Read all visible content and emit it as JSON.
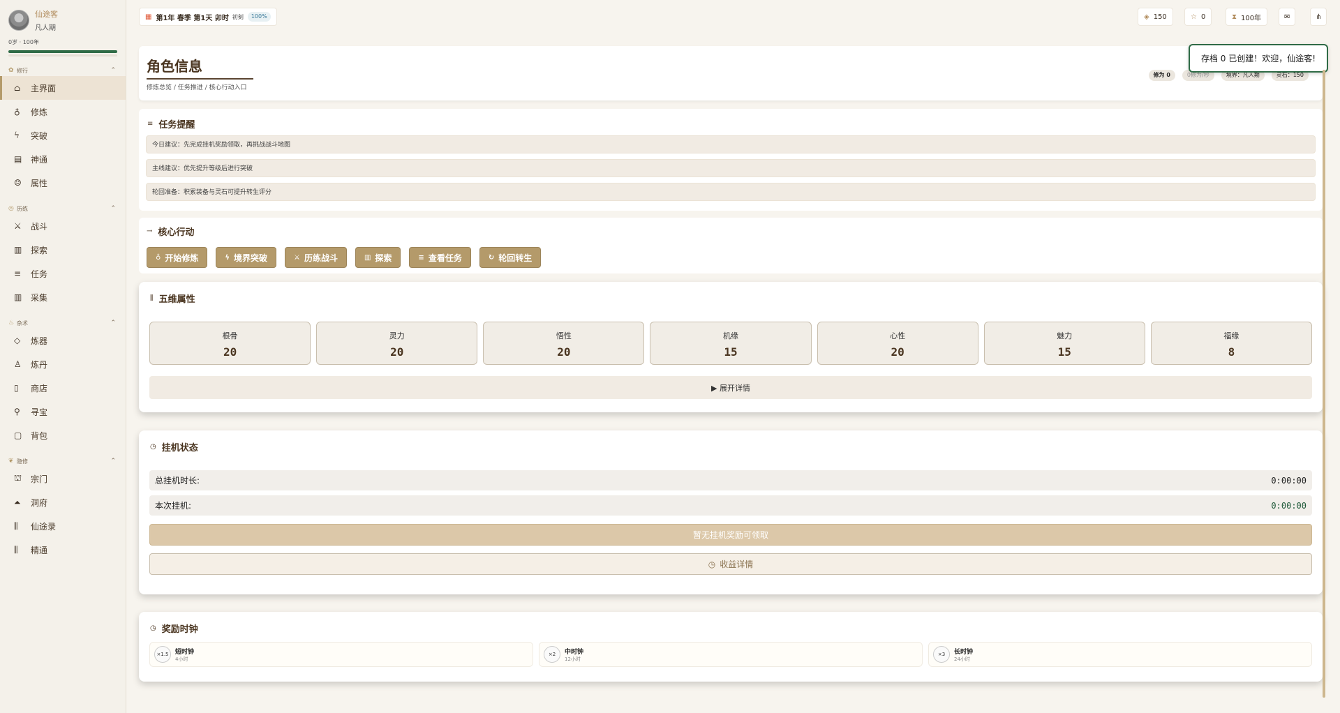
{
  "profile": {
    "name": "仙途客",
    "realm": "凡人期",
    "age_line": "0岁 · 100年",
    "progress": 1.0
  },
  "sections": [
    {
      "title": "修行",
      "items": [
        "主界面",
        "修炼",
        "突破",
        "神通",
        "属性"
      ]
    },
    {
      "title": "历练",
      "items": [
        "战斗",
        "探索",
        "任务",
        "采集"
      ]
    },
    {
      "title": "杂术",
      "items": [
        "炼器",
        "炼丹",
        "商店",
        "寻宝",
        "背包"
      ]
    },
    {
      "title": "隐修",
      "items": [
        "宗门",
        "洞府",
        "仙途录",
        "精通"
      ]
    }
  ],
  "topbar": {
    "date": "第1年 春季 第1天 卯时",
    "period": "初刻",
    "pct": "100%",
    "spirit": "150",
    "stars": "0",
    "years": "100年"
  },
  "toast": "存档 0 已创建！欢迎，仙途客!",
  "page": {
    "title": "角色信息",
    "subtitle": "修炼总览 / 任务推进 / 核心行动入口",
    "stats": [
      "修为 0",
      "0修为/秒",
      "境界：凡人期",
      "灵石：150"
    ]
  },
  "tasks": {
    "title": "任务提醒",
    "items": [
      "今日建议：先完成挂机奖励领取，再挑战战斗地图",
      "主线建议：优先提升等级后进行突破",
      "轮回准备：积累装备与灵石可提升转生评分"
    ]
  },
  "actions": {
    "title": "核心行动",
    "buttons": [
      "开始修炼",
      "境界突破",
      "历练战斗",
      "探索",
      "查看任务",
      "轮回转生"
    ]
  },
  "attributes": {
    "title": "五维属性",
    "items": [
      {
        "label": "根骨",
        "value": "20"
      },
      {
        "label": "灵力",
        "value": "20"
      },
      {
        "label": "悟性",
        "value": "20"
      },
      {
        "label": "机缘",
        "value": "15"
      },
      {
        "label": "心性",
        "value": "20"
      },
      {
        "label": "魅力",
        "value": "15"
      },
      {
        "label": "福缘",
        "value": "8"
      }
    ],
    "expand": "▶ 展开详情"
  },
  "idle": {
    "title": "挂机状态",
    "total_label": "总挂机时长:",
    "total_value": "0:00:00",
    "session_label": "本次挂机:",
    "session_value": "0:00:00",
    "claim": "暂无挂机奖励可领取",
    "detail": "收益详情"
  },
  "clocks": {
    "title": "奖励时钟",
    "items": [
      {
        "mult": "×1.5",
        "name": "短时钟",
        "dur": "4小时"
      },
      {
        "mult": "×2",
        "name": "中时钟",
        "dur": "12小时"
      },
      {
        "mult": "×3",
        "name": "长时钟",
        "dur": "24小时"
      }
    ]
  }
}
